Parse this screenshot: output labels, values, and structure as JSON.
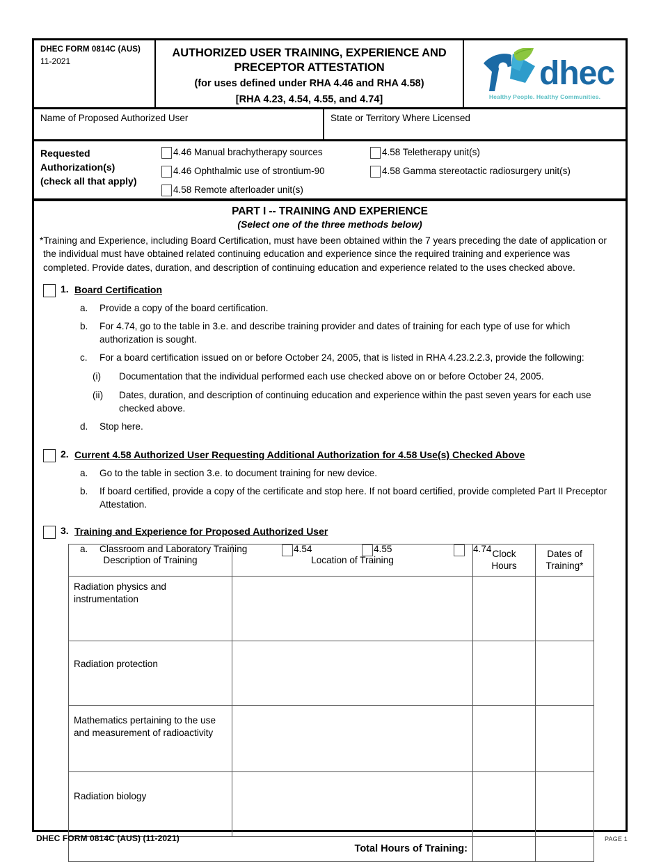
{
  "header": {
    "form_number": "DHEC FORM 0814C (AUS)",
    "form_date": "11-2021",
    "title_line1": "AUTHORIZED USER TRAINING, EXPERIENCE AND",
    "title_line2": "PRECEPTOR ATTESTATION",
    "subtitle_line1": "(for uses defined under RHA 4.46 and RHA 4.58)",
    "subtitle_line2": "[RHA 4.23, 4.54, 4.55, and 4.74]",
    "logo_text": "dhec",
    "logo_tagline": "Healthy People. Healthy Communities."
  },
  "fields": {
    "name_label": "Name of Proposed Authorized User",
    "name_value": "",
    "state_label": "State or Territory Where Licensed",
    "state_value": ""
  },
  "requested_authorizations": {
    "label_line1": "Requested",
    "label_line2": "Authorization(s)",
    "label_line3": "(check all that apply)",
    "options": [
      {
        "label": "4.46 Manual brachytherapy sources",
        "checked": false
      },
      {
        "label": "4.58 Teletherapy unit(s)",
        "checked": false
      },
      {
        "label": "4.46 Ophthalmic use of strontium-90",
        "checked": false
      },
      {
        "label": "4.58 Gamma stereotactic radiosurgery unit(s)",
        "checked": false
      },
      {
        "label": "4.58 Remote afterloader unit(s)",
        "checked": false
      }
    ]
  },
  "part1": {
    "title": "PART I -- TRAINING AND EXPERIENCE",
    "subtitle": "(Select one of the three methods below)",
    "intro": "*Training and Experience, including Board Certification, must have been obtained within the 7 years preceding the date of application or the individual must have obtained related continuing education and experience since the required training and experience was completed. Provide dates, duration, and description of continuing education and experience related to the uses checked above.",
    "item1": {
      "number": "1.",
      "heading": "Board Certification",
      "checked": false,
      "a_marker": "a.",
      "a_text": "Provide a copy of the board certification.",
      "b_marker": "b.",
      "b_text": "For 4.74, go to the table in 3.e. and describe training provider and dates of training for each type of use for which authorization is sought.",
      "c_marker": "c.",
      "c_text": "For a board certification issued on or before October 24, 2005, that is listed in RHA 4.23.2.2.3, provide the following:",
      "c_i_marker": "(i)",
      "c_i_text": "Documentation that the individual performed each use checked above on or before October 24, 2005.",
      "c_ii_marker": "(ii)",
      "c_ii_text": "Dates, duration, and description of continuing education and experience within the past seven years for each use checked above.",
      "d_marker": "d.",
      "d_text": "Stop here."
    },
    "item2": {
      "number": "2.",
      "heading": "Current 4.58 Authorized User Requesting Additional Authorization for 4.58 Use(s) Checked Above",
      "checked": false,
      "a_marker": "a.",
      "a_text": "Go to the table in section 3.e. to document training for new device.",
      "b_marker": "b.",
      "b_text": "If board certified, provide a copy of the certificate and stop here. If not board certified, provide completed Part II Preceptor Attestation."
    },
    "item3": {
      "number": "3.",
      "heading": "Training and Experience for Proposed Authorized User",
      "checked": false,
      "a_marker": "a.",
      "a_text": "Classroom and Laboratory Training",
      "a_checkboxes": [
        {
          "label": "4.54",
          "checked": false
        },
        {
          "label": "4.55",
          "checked": false
        },
        {
          "label": "4.74",
          "checked": false
        }
      ]
    }
  },
  "training_table": {
    "columns": [
      "Description of Training",
      "Location of Training",
      "Clock Hours",
      "Dates of Training*"
    ],
    "col_header_clock_l1": "Clock",
    "col_header_clock_l2": "Hours",
    "col_header_dates_l1": "Dates of",
    "col_header_dates_l2": "Training*",
    "rows": [
      {
        "description": "Radiation physics and instrumentation",
        "location": "",
        "clock_hours": "",
        "dates": ""
      },
      {
        "description": "Radiation protection",
        "location": "",
        "clock_hours": "",
        "dates": ""
      },
      {
        "description": "Mathematics pertaining to the use and measurement of radioactivity",
        "location": "",
        "clock_hours": "",
        "dates": ""
      },
      {
        "description": "Radiation biology",
        "location": "",
        "clock_hours": "",
        "dates": ""
      }
    ],
    "total_label": "Total Hours of Training:",
    "total_value": ""
  },
  "footer": {
    "left": "DHEC FORM 0814C (AUS)  (11-2021)",
    "right": "PAGE 1"
  },
  "colors": {
    "logo_dark_blue": "#1b6aa5",
    "logo_mid_blue": "#2e9ccb",
    "logo_light_blue": "#5ec6e0",
    "logo_green": "#8cc63f",
    "logo_tagline": "#5bbfc4"
  }
}
